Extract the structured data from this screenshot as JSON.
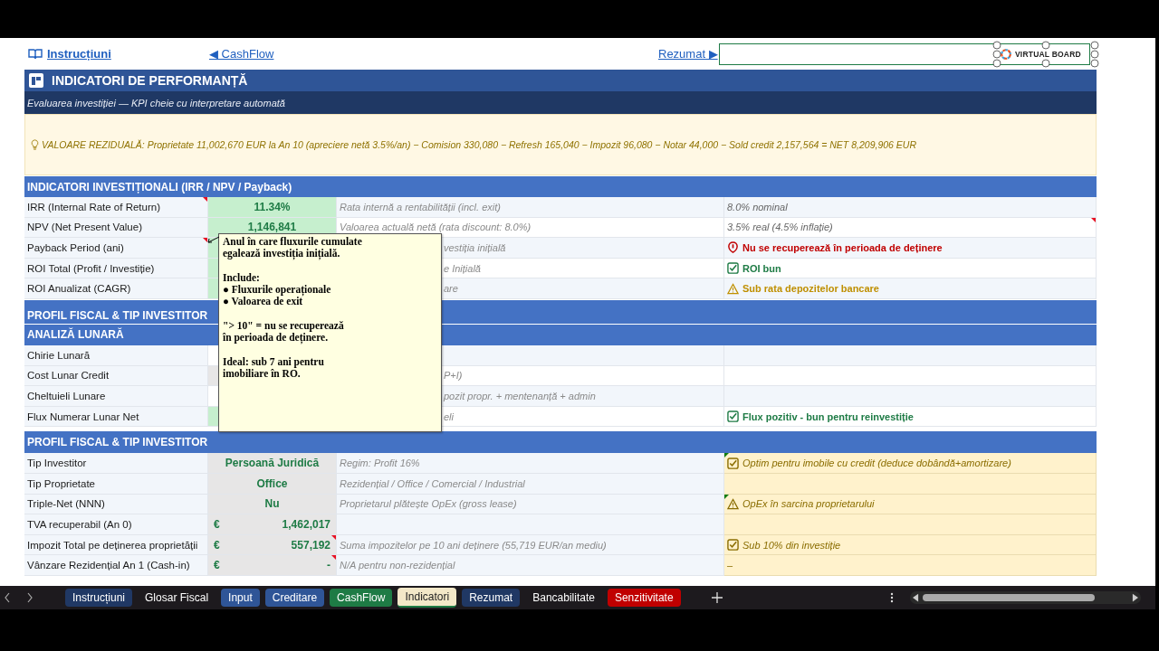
{
  "nav_links": [
    {
      "label": "Instrucțiuni",
      "kind": "book"
    },
    {
      "label": "◀ CashFlow",
      "kind": "plain"
    },
    {
      "label": "Rezumat ▶",
      "kind": "plain"
    }
  ],
  "logo": {
    "text": "VIRTUAL BOARD"
  },
  "title": "INDICATORI DE PERFORMANȚĂ",
  "subtitle": "Evaluarea investiției — KPI cheie cu interpretare automată",
  "residual": "VALOARE REZIDUALĂ: Proprietate 11,002,670 EUR la An 10 (apreciere netă 3.5%/an) − Comision 330,080 − Refresh 165,040 − Impozit 96,080 − Notar 44,000 − Sold credit 2,157,564 = NET 8,209,906 EUR",
  "sections": [
    {
      "title": "INDICATORI INVESTIȚIONALI (IRR / NPV / Payback)",
      "kind": "kpi",
      "rows": [
        {
          "label": "IRR (Internal Rate of Return)",
          "value": {
            "text": "11.34%",
            "kind": "green"
          },
          "desc": "Rata internă a rentabilității (incl. exit)",
          "note": {
            "text": "8.0% nominal",
            "kind": "plain"
          },
          "marker": {
            "kind": "label",
            "color": "#e81123"
          }
        },
        {
          "label": "NPV (Net Present Value)",
          "value": {
            "text": "1,146,841",
            "kind": "green"
          },
          "desc": "Valoarea actuală netă (rata discount: 8.0%)",
          "note": {
            "text": "3.5% real (4.5% inflație)",
            "kind": "plain"
          },
          "marker": {
            "kind": "note",
            "color": "#e81123"
          }
        },
        {
          "label": "Payback Period (ani)",
          "value": {
            "kind": "green"
          },
          "desc": "vestiția inițială",
          "hidden_desc": true,
          "note": {
            "text": "Nu se recuperează în perioada de deținere",
            "kind": "bad"
          },
          "marker": {
            "kind": "label",
            "color": "#e81123"
          }
        },
        {
          "label": "ROI Total (Profit / Investiție)",
          "value": {
            "kind": "green"
          },
          "desc": "e Inițială",
          "hidden_desc": true,
          "note": {
            "text": "ROI bun",
            "kind": "good"
          }
        },
        {
          "label": "ROI Anualizat (CAGR)",
          "value": {
            "kind": "green"
          },
          "desc": "are",
          "hidden_desc": true,
          "note": {
            "text": "Sub rata depozitelor bancare",
            "kind": "warn"
          }
        }
      ]
    },
    {
      "title": "PROFIL FISCAL & TIP INVESTITOR",
      "kind": "kpi"
    },
    {
      "title": "ANALIZĂ LUNARĂ",
      "kind": "kpi",
      "rows": [
        {
          "label": "Chirie Lunară",
          "value": {
            "kind": "none"
          }
        },
        {
          "label": "Cost Lunar Credit",
          "value": {
            "kind": "grey"
          },
          "desc": "P+I)",
          "hidden_desc": true
        },
        {
          "label": "Cheltuieli Lunare",
          "value": {
            "kind": "none"
          },
          "desc": "pozit propr. + mentenanță + admin",
          "hidden_desc": true
        },
        {
          "label": "Flux Numerar Lunar Net",
          "value": {
            "kind": "green"
          },
          "desc": "eli",
          "hidden_desc": true,
          "note": {
            "text": "Flux pozitiv - bun pentru reinvestiție",
            "kind": "good"
          }
        }
      ]
    },
    {
      "title": "PROFIL FISCAL & TIP INVESTITOR",
      "kind": "fiscal",
      "rows": [
        {
          "label": "Tip Investitor",
          "value": {
            "text": "Persoană Juridică",
            "kind": "grey"
          },
          "desc": "Regim: Profit 16%",
          "note": {
            "text": "Optim pentru imobile cu credit (deduce dobândă+amortizare)",
            "kind": "ok"
          },
          "marker": {
            "kind": "note",
            "color": "#107c10"
          }
        },
        {
          "label": "Tip Proprietate",
          "value": {
            "text": "Office",
            "kind": "grey"
          },
          "desc": "Rezidențial / Office / Comercial / Industrial"
        },
        {
          "label": "Triple-Net (NNN)",
          "value": {
            "text": "Nu",
            "kind": "grey"
          },
          "desc": "Proprietarul plătește OpEx (gross lease)",
          "note": {
            "text": "OpEx în sarcina proprietarului",
            "kind": "warn"
          },
          "marker": {
            "kind": "note",
            "color": "#107c10"
          }
        },
        {
          "label": "TVA recuperabil (An 0)",
          "currency": "€",
          "value": {
            "text": "1,462,017",
            "kind": "grey"
          }
        },
        {
          "label": "Impozit Total pe deținerea proprietății",
          "currency": "€",
          "value": {
            "text": "557,192",
            "kind": "grey"
          },
          "desc": "Suma impozitelor pe 10 ani deținere (55,719 EUR/an mediu)",
          "note": {
            "text": "Sub 10% din investiție",
            "kind": "ok"
          },
          "marker": {
            "kind": "value",
            "color": "#e81123"
          }
        },
        {
          "label": "Vânzare Rezidențial An 1 (Cash-in)",
          "currency": "€",
          "value": {
            "text": "-",
            "kind": "grey"
          },
          "desc": "N/A pentru non-rezidențial",
          "note": {
            "text": "–",
            "kind": "plain"
          },
          "marker": {
            "kind": "value",
            "color": "#e81123"
          }
        }
      ]
    }
  ],
  "comment": {
    "paragraphs": [
      [
        "Anul în care fluxurile cumulate",
        "egalează investiția inițială."
      ],
      [
        "Include:",
        "● Fluxurile operaționale",
        "● Valoarea de exit"
      ],
      [
        "\"> 10\" = nu se recuperează",
        "în perioada de deținere."
      ],
      [
        "Ideal: sub 7 ani pentru",
        "imobiliare în RO."
      ]
    ]
  },
  "tabs": [
    {
      "label": "Instrucțiuni",
      "color": "#203864",
      "selected": false
    },
    {
      "label": "Glosar Fiscal",
      "selected": false
    },
    {
      "label": "Input",
      "color": "#2f5597",
      "selected": false
    },
    {
      "label": "Creditare",
      "color": "#2f5597",
      "selected": false
    },
    {
      "label": "CashFlow",
      "color": "#1e7b45",
      "selected": false
    },
    {
      "label": "Indicatori",
      "selected": true
    },
    {
      "label": "Rezumat",
      "color": "#203864",
      "selected": false
    },
    {
      "label": "Bancabilitate",
      "selected": false
    },
    {
      "label": "Senzitivitate",
      "color": "#c00000",
      "selected": false
    }
  ]
}
